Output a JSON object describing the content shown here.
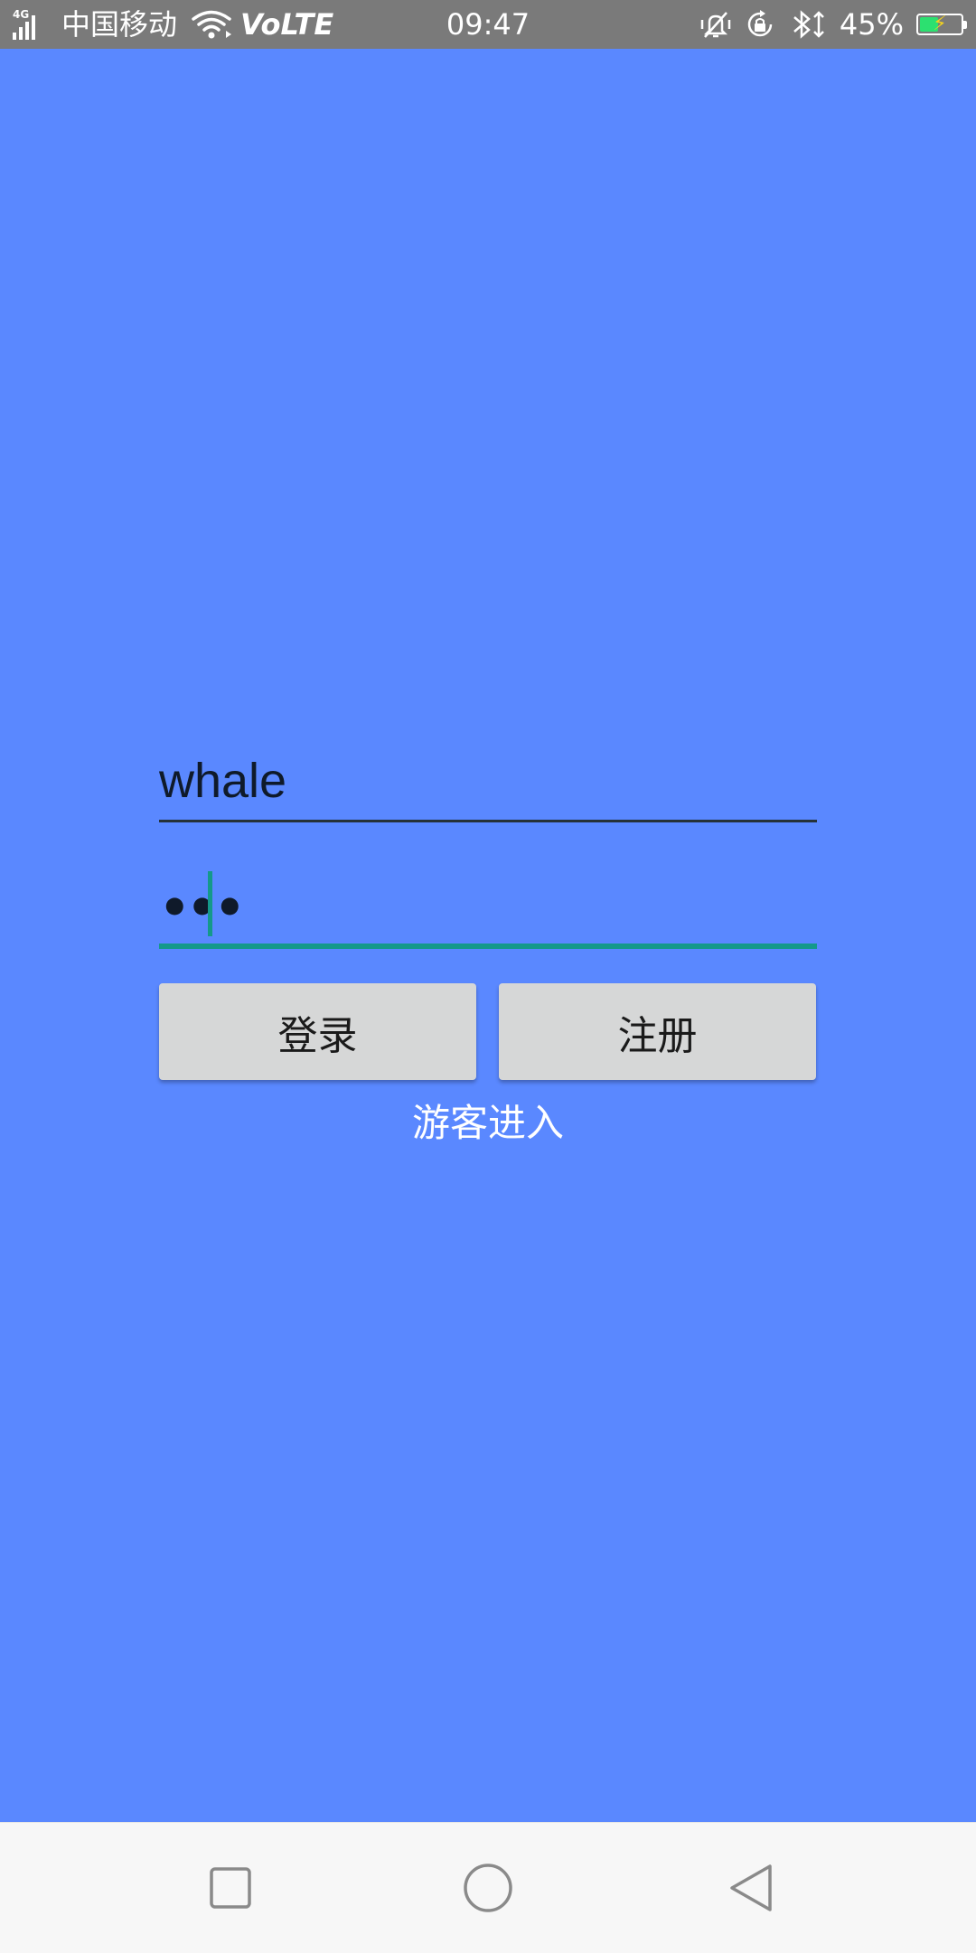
{
  "status_bar": {
    "network_type": "4G",
    "carrier": "中国移动",
    "volte": "VoLTE",
    "time": "09:47",
    "battery_percent": "45%",
    "battery_level": 0.45,
    "icons": [
      "signal-icon",
      "wifi-icon",
      "mute-icon",
      "rotation-lock-icon",
      "bluetooth-icon",
      "battery-icon"
    ]
  },
  "login": {
    "username_value": "whale",
    "password_value": "•••",
    "login_label": "登录",
    "register_label": "注册",
    "guest_label": "游客进入"
  },
  "nav_bar": {
    "icons": [
      "recent-apps-icon",
      "home-icon",
      "back-icon"
    ]
  },
  "colors": {
    "background": "#5a88ff",
    "accent": "#14998a",
    "button": "#d6d7d7",
    "status_bar": "#7a7a7a",
    "nav_bar": "#f7f7f7"
  }
}
